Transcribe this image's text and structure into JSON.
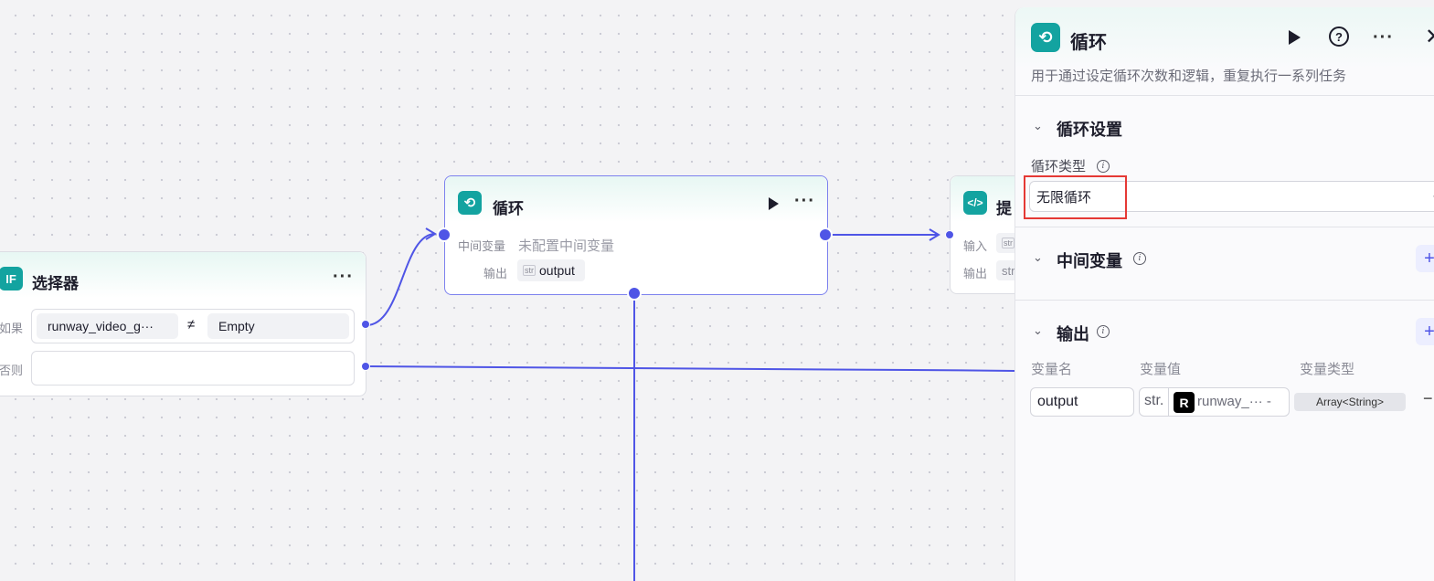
{
  "canvas": {
    "selector_node": {
      "title": "选择器",
      "icon_text": "IF",
      "if_label": "如果",
      "else_label": "否则",
      "left_operand": "runway_video_g···",
      "operator": "≠",
      "right_operand": "Empty"
    },
    "loop_node": {
      "title": "循环",
      "intermediate_label": "中间变量",
      "intermediate_value": "未配置中间变量",
      "output_label": "输出",
      "output_type": "str",
      "output_value": "output"
    },
    "code_node": {
      "title": "提",
      "input_label": "输入",
      "input_type": "str",
      "output_label": "输出",
      "output_type": "str"
    }
  },
  "panel": {
    "title": "循环",
    "description": "用于通过设定循环次数和逻辑，重复执行一系列任务",
    "loop_settings": {
      "title": "循环设置",
      "type_label": "循环类型",
      "type_value": "无限循环"
    },
    "intermediate": {
      "title": "中间变量"
    },
    "output": {
      "title": "输出",
      "col_name": "变量名",
      "col_value": "变量值",
      "col_type": "变量类型",
      "row": {
        "name": "output",
        "value_prefix": "str.",
        "value_text": "runway_··· -",
        "type": "Array<String>"
      }
    }
  },
  "colors": {
    "accent": "#4f55e6",
    "node_icon": "#13a3a0",
    "highlight": "#e53935"
  }
}
